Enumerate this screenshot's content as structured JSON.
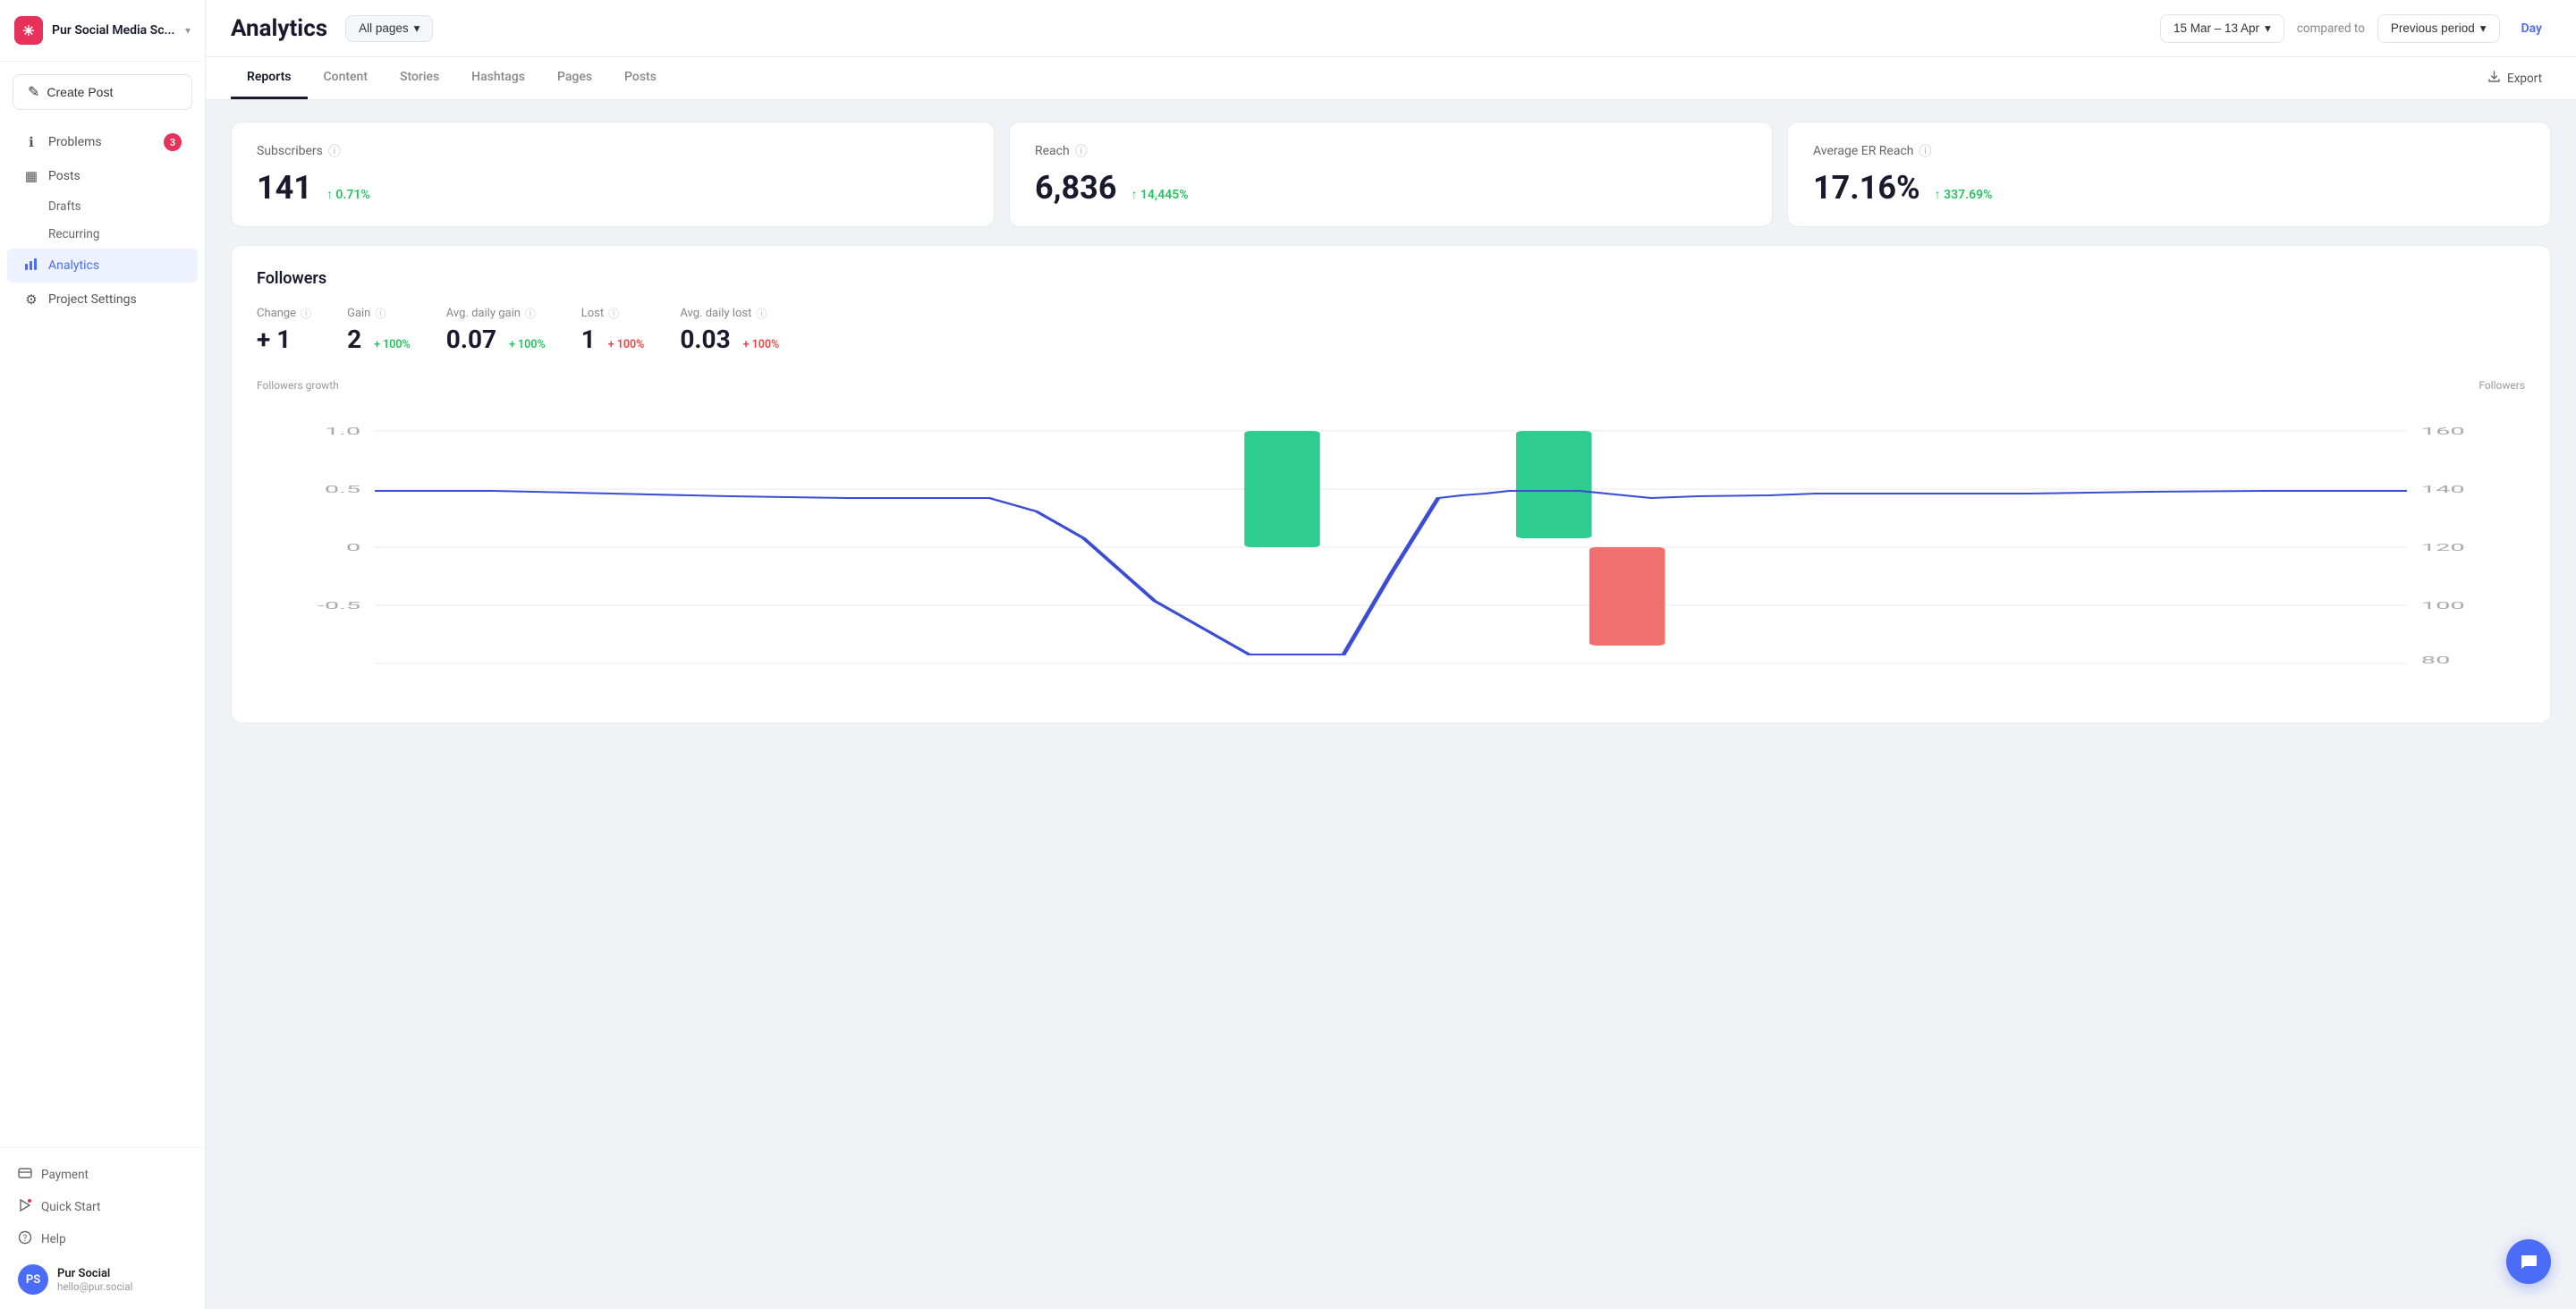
{
  "app": {
    "logo_text": "✳",
    "name": "Pur Social Media Sc...",
    "chevron": "▾"
  },
  "sidebar": {
    "create_post_label": "Create Post",
    "create_post_icon": "+",
    "nav_items": [
      {
        "id": "problems",
        "label": "Problems",
        "icon": "ℹ",
        "badge": "3",
        "active": false
      },
      {
        "id": "posts",
        "label": "Posts",
        "icon": "▦",
        "badge": null,
        "active": false
      },
      {
        "id": "drafts",
        "label": "Drafts",
        "icon": null,
        "badge": null,
        "sub": true
      },
      {
        "id": "recurring",
        "label": "Recurring",
        "icon": null,
        "badge": null,
        "sub": true
      },
      {
        "id": "analytics",
        "label": "Analytics",
        "icon": "📊",
        "badge": null,
        "active": true
      }
    ],
    "project_settings_label": "Project Settings",
    "project_settings_icon": "⚙",
    "footer_items": [
      {
        "id": "payment",
        "label": "Payment",
        "icon": "💳"
      },
      {
        "id": "quick-start",
        "label": "Quick Start",
        "icon": "🚀"
      },
      {
        "id": "help",
        "label": "Help",
        "icon": "❓"
      }
    ],
    "user": {
      "name": "Pur Social",
      "email": "hello@pur.social",
      "avatar_initials": "PS"
    }
  },
  "header": {
    "title": "Analytics",
    "all_pages_label": "All pages",
    "date_range": "15 Mar – 13 Apr",
    "compared_to_label": "compared to",
    "previous_period_label": "Previous period",
    "day_label": "Day"
  },
  "tabs": {
    "items": [
      {
        "id": "reports",
        "label": "Reports",
        "active": true
      },
      {
        "id": "content",
        "label": "Content",
        "active": false
      },
      {
        "id": "stories",
        "label": "Stories",
        "active": false
      },
      {
        "id": "hashtags",
        "label": "Hashtags",
        "active": false
      },
      {
        "id": "pages",
        "label": "Pages",
        "active": false
      },
      {
        "id": "posts",
        "label": "Posts",
        "active": false
      }
    ],
    "export_label": "Export"
  },
  "metrics": [
    {
      "id": "subscribers",
      "label": "Subscribers",
      "value": "141",
      "change": "↑ 0.71%",
      "change_type": "up"
    },
    {
      "id": "reach",
      "label": "Reach",
      "value": "6,836",
      "change": "↑ 14,445%",
      "change_type": "up"
    },
    {
      "id": "avg-er-reach",
      "label": "Average ER Reach",
      "value": "17.16%",
      "change": "↑ 337.69%",
      "change_type": "up"
    }
  ],
  "followers": {
    "section_title": "Followers",
    "stats": [
      {
        "id": "change",
        "label": "Change",
        "value": "+ 1",
        "change": null
      },
      {
        "id": "gain",
        "label": "Gain",
        "value": "2",
        "change": "+ 100%",
        "change_type": "up"
      },
      {
        "id": "avg-daily-gain",
        "label": "Avg. daily gain",
        "value": "0.07",
        "change": "+ 100%",
        "change_type": "up"
      },
      {
        "id": "lost",
        "label": "Lost",
        "value": "1",
        "change": "+ 100%",
        "change_type": "down"
      },
      {
        "id": "avg-daily-lost",
        "label": "Avg. daily lost",
        "value": "0.03",
        "change": "+ 100%",
        "change_type": "down"
      }
    ],
    "chart": {
      "left_label": "Followers growth",
      "right_label": "Followers",
      "y_left": [
        "1.0",
        "0.5",
        "0",
        "-0.5"
      ],
      "y_right": [
        "160",
        "140",
        "120",
        "100",
        "80"
      ]
    }
  }
}
